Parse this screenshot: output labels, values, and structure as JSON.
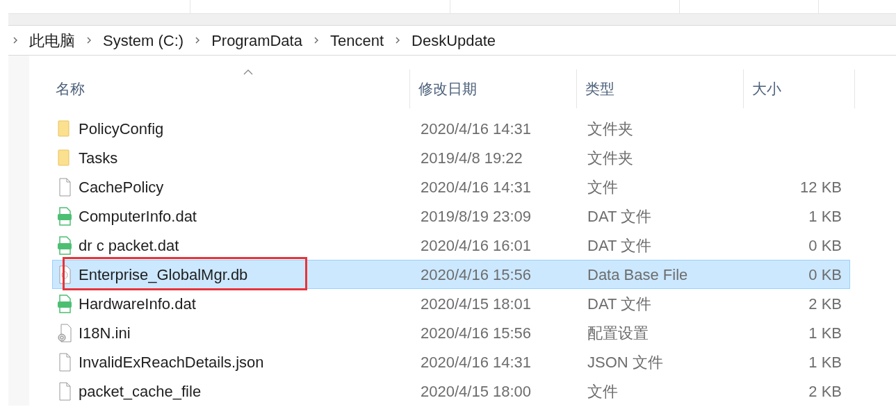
{
  "breadcrumb": [
    "此电脑",
    "System (C:)",
    "ProgramData",
    "Tencent",
    "DeskUpdate"
  ],
  "columns": [
    "名称",
    "修改日期",
    "类型",
    "大小"
  ],
  "rows": [
    {
      "kind": "folder",
      "name": "PolicyConfig",
      "date": "2020/4/16 14:31",
      "type": "文件夹",
      "selected": false,
      "annotated": false
    },
    {
      "kind": "folder",
      "name": "Tasks",
      "date": "2019/4/8 19:22",
      "type": "文件夹",
      "selected": false,
      "annotated": false
    },
    {
      "kind": "file",
      "name": "CachePolicy",
      "date": "2020/4/16 14:31",
      "type": "文件",
      "size": "12 KB",
      "selected": false,
      "annotated": false
    },
    {
      "kind": "vcd",
      "name": "ComputerInfo.dat",
      "date": "2019/8/19 23:09",
      "type": "DAT 文件",
      "size": "1 KB",
      "selected": false,
      "annotated": false
    },
    {
      "kind": "vcd",
      "name": "dr c packet.dat",
      "date": "2020/4/16 16:01",
      "type": "DAT 文件",
      "size": "0 KB",
      "selected": false,
      "annotated": false
    },
    {
      "kind": "db",
      "name": "Enterprise_GlobalMgr.db",
      "date": "2020/4/16 15:56",
      "type": "Data Base File",
      "size": "0 KB",
      "selected": true,
      "annotated": true
    },
    {
      "kind": "vcd",
      "name": "HardwareInfo.dat",
      "date": "2020/4/15 18:01",
      "type": "DAT 文件",
      "size": "2 KB",
      "selected": false,
      "annotated": false
    },
    {
      "kind": "ini",
      "name": "I18N.ini",
      "date": "2020/4/16 15:56",
      "type": "配置设置",
      "size": "1 KB",
      "selected": false,
      "annotated": false
    },
    {
      "kind": "file",
      "name": "InvalidExReachDetails.json",
      "date": "2020/4/16 14:31",
      "type": "JSON 文件",
      "size": "1 KB",
      "selected": false,
      "annotated": false
    },
    {
      "kind": "file",
      "name": "packet_cache_file",
      "date": "2020/4/15 18:00",
      "type": "文件",
      "size": "2 KB",
      "selected": false,
      "annotated": false
    }
  ]
}
